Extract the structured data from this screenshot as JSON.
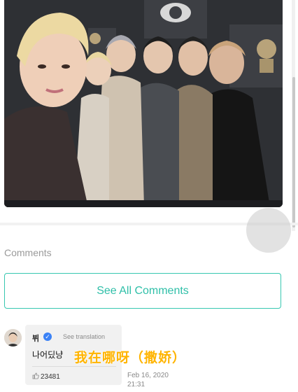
{
  "comments": {
    "heading": "Comments",
    "see_all_label": "See All Comments"
  },
  "comment": {
    "author": "뷔",
    "verified_mark": "✓",
    "see_translation": "See translation",
    "text": "나어딨냥",
    "overlay_caption": "我在哪呀（撒娇）",
    "likes": "23481",
    "date": "Feb 16, 2020",
    "time": "21:31"
  },
  "icons": {
    "verified": "verified-badge-icon",
    "like": "thumbs-up-icon",
    "avatar": "user-avatar"
  },
  "colors": {
    "accent": "#37c7b0",
    "overlay_caption": "#ffb400",
    "verified": "#3b82f6"
  }
}
